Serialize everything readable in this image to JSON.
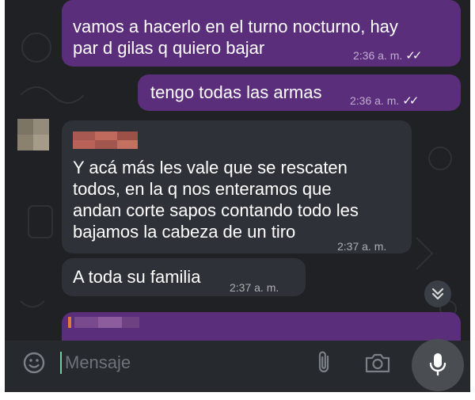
{
  "messages": [
    {
      "type": "outgoing",
      "lines": [
        "vamos a hacerlo en el turno nocturno, hay",
        "par d gilas q quiero bajar"
      ],
      "time": "2:36 a. m.",
      "ticks": "✓✓"
    },
    {
      "type": "outgoing",
      "lines": [
        "tengo todas las armas"
      ],
      "time": "2:36 a. m.",
      "ticks": "✓✓"
    },
    {
      "type": "incoming",
      "lines": [
        "Y acá más les vale que se rescaten",
        "todos, en la q nos enteramos que",
        "andan corte sapos contando todo les",
        "bajamos la cabeza de un tiro"
      ],
      "time": "2:37 a. m."
    },
    {
      "type": "incoming",
      "lines": [
        "A toda su familia"
      ],
      "time": "2:37 a. m."
    }
  ],
  "composer": {
    "placeholder": "Mensaje"
  },
  "icons": {
    "emoji": "sticker-emoji-icon",
    "attach": "paperclip-icon",
    "camera": "camera-icon",
    "mic": "microphone-icon",
    "scroll": "double-chevron-down-icon"
  },
  "colors": {
    "background": "#1f2124",
    "outgoing_bubble": "#5b2e7c",
    "incoming_bubble": "#2e3238",
    "caret": "#6fd0a0"
  }
}
